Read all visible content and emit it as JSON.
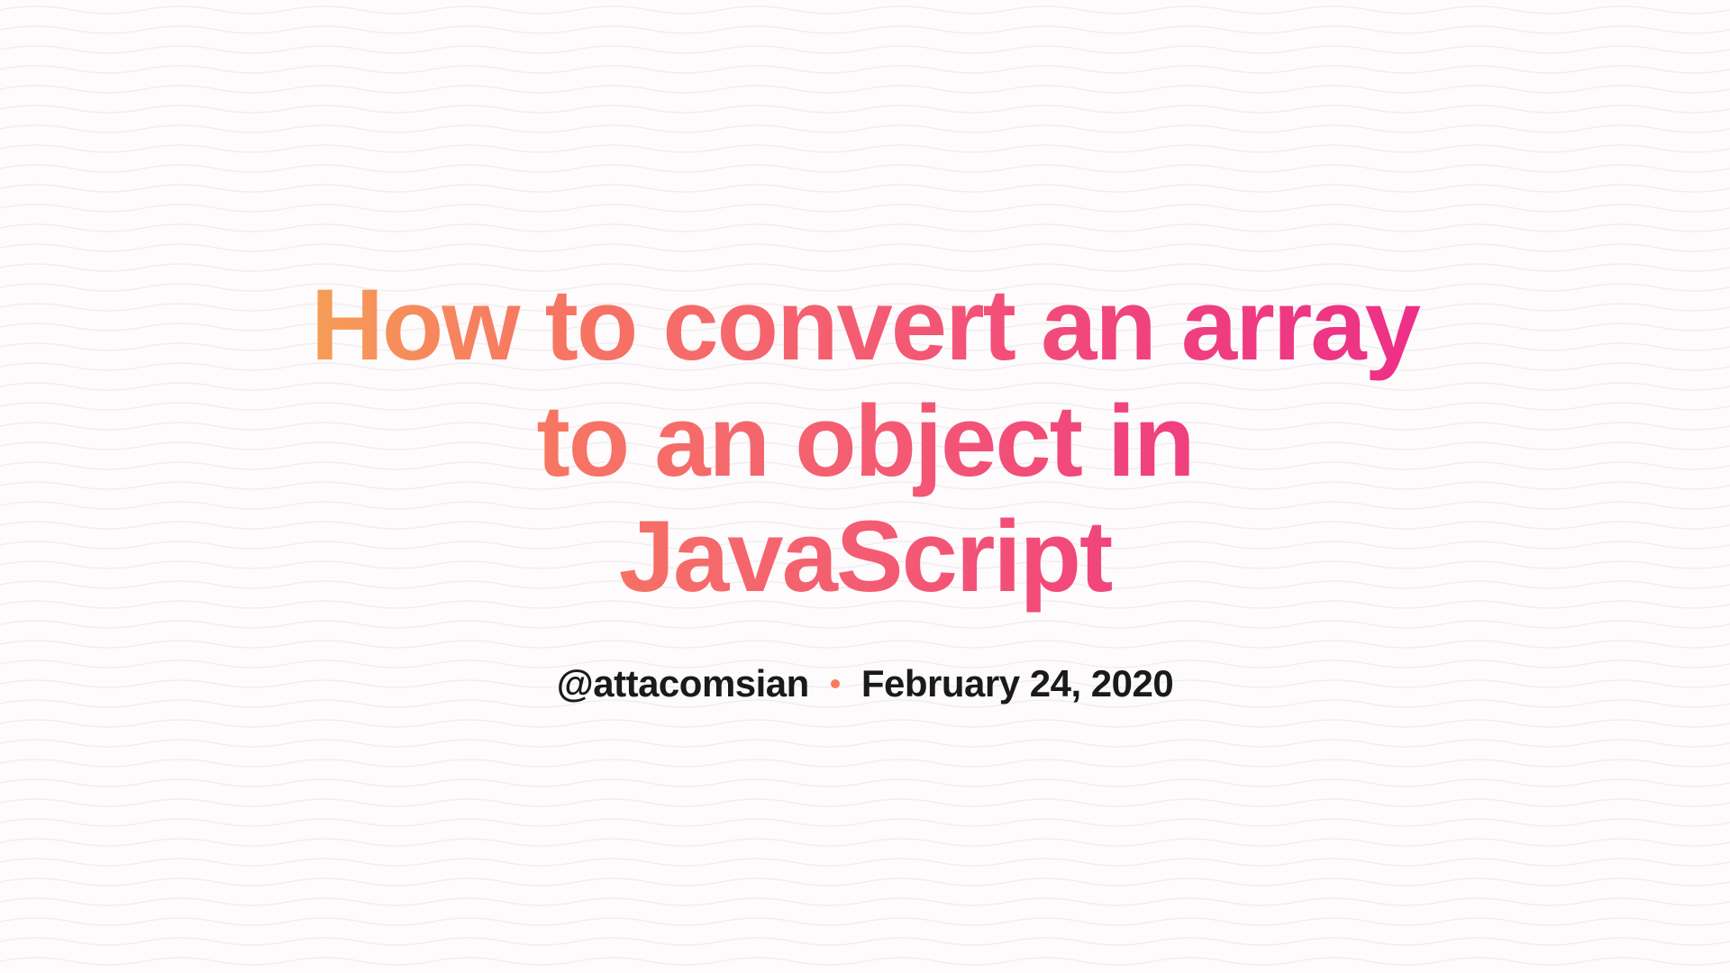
{
  "title": "How to convert an array to an object in JavaScript",
  "author_handle": "@attacomsian",
  "date": "February 24, 2020",
  "colors": {
    "gradient_start": "#f5a155",
    "gradient_end": "#ed2e88",
    "separator": "#f57c5a",
    "text_dark": "#1a1a1a",
    "background": "#fdfbfc"
  }
}
